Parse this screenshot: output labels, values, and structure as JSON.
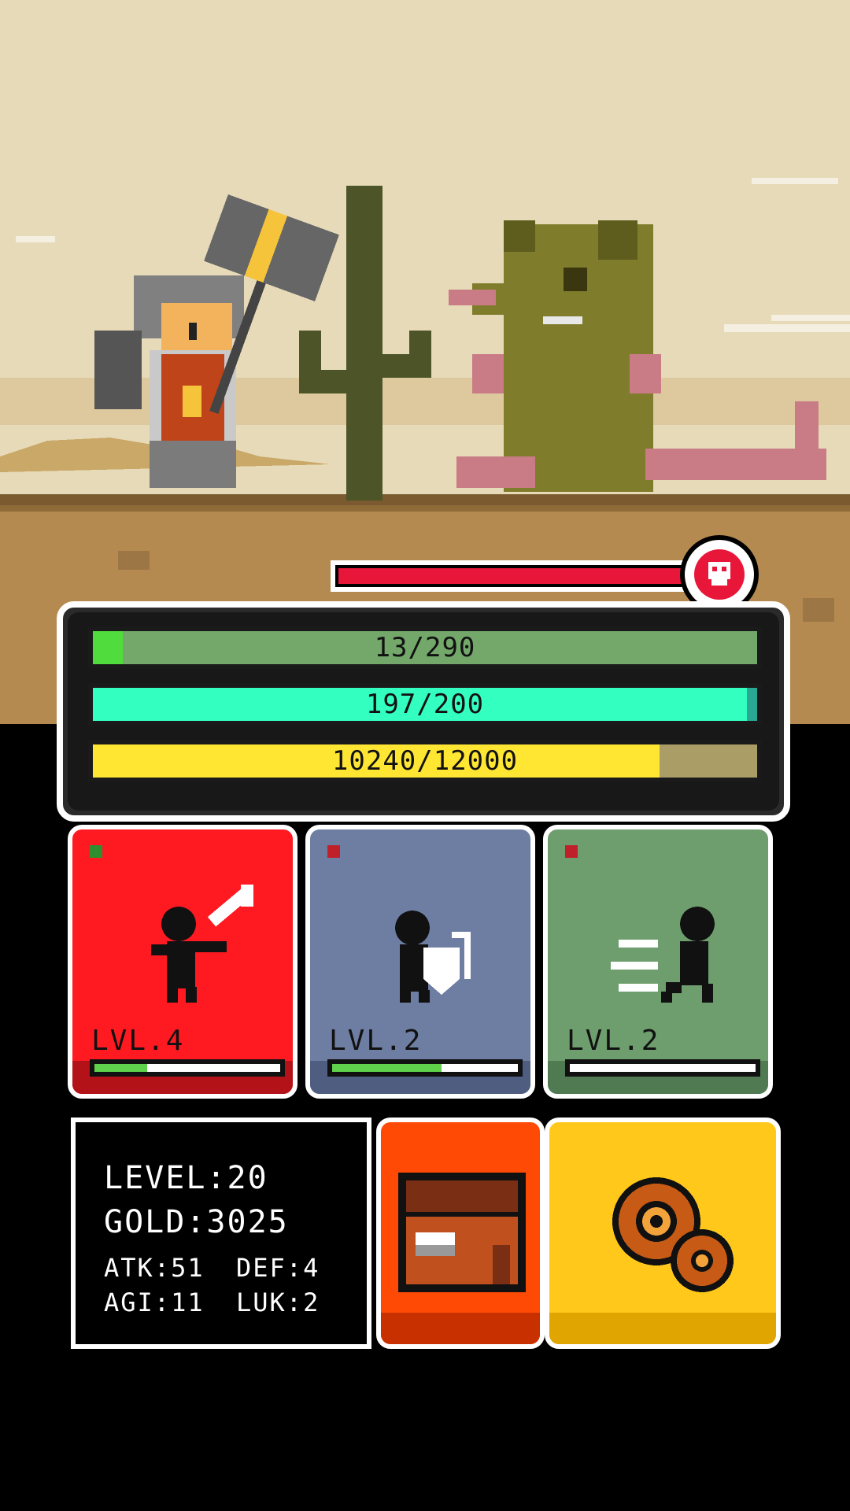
{
  "bars": {
    "health": {
      "text": "13/290",
      "current": 13,
      "max": 290,
      "color": "#4fdc3c",
      "track": "#73a86a"
    },
    "energy": {
      "text": "197/200",
      "current": 197,
      "max": 200,
      "color": "#33ffc0",
      "track": "#2aa894"
    },
    "experience": {
      "text": "10240/12000",
      "current": 10240,
      "max": 12000,
      "color": "#ffe633",
      "track": "#aa9d66"
    }
  },
  "enemy": {
    "health_fraction": 1.0,
    "icon": "skull-icon",
    "color": "#e8173a"
  },
  "skills": [
    {
      "name": "attack",
      "label": "LVL.4",
      "progress": 0.3,
      "color": "#ff1a22",
      "shade": "#b31219",
      "icon": "sword-attack-icon"
    },
    {
      "name": "defense",
      "label": "LVL.2",
      "progress": 0.6,
      "color": "#6e7ea3",
      "shade": "#4e5d80",
      "icon": "shield-defense-icon"
    },
    {
      "name": "agility",
      "label": "LVL.2",
      "progress": 0.02,
      "color": "#6e9e6e",
      "shade": "#4f7a52",
      "icon": "running-agility-icon"
    }
  ],
  "stats": {
    "level": "LEVEL:20",
    "gold": "GOLD:3025",
    "atk": "ATK:51",
    "def": "DEF:4",
    "agi": "AGI:11",
    "luk": "LUK:2"
  },
  "buttons": {
    "inventory": {
      "icon": "treasure-chest-icon",
      "color": "#ff4a06"
    },
    "settings": {
      "icon": "gears-icon",
      "color": "#ffc81a"
    }
  }
}
